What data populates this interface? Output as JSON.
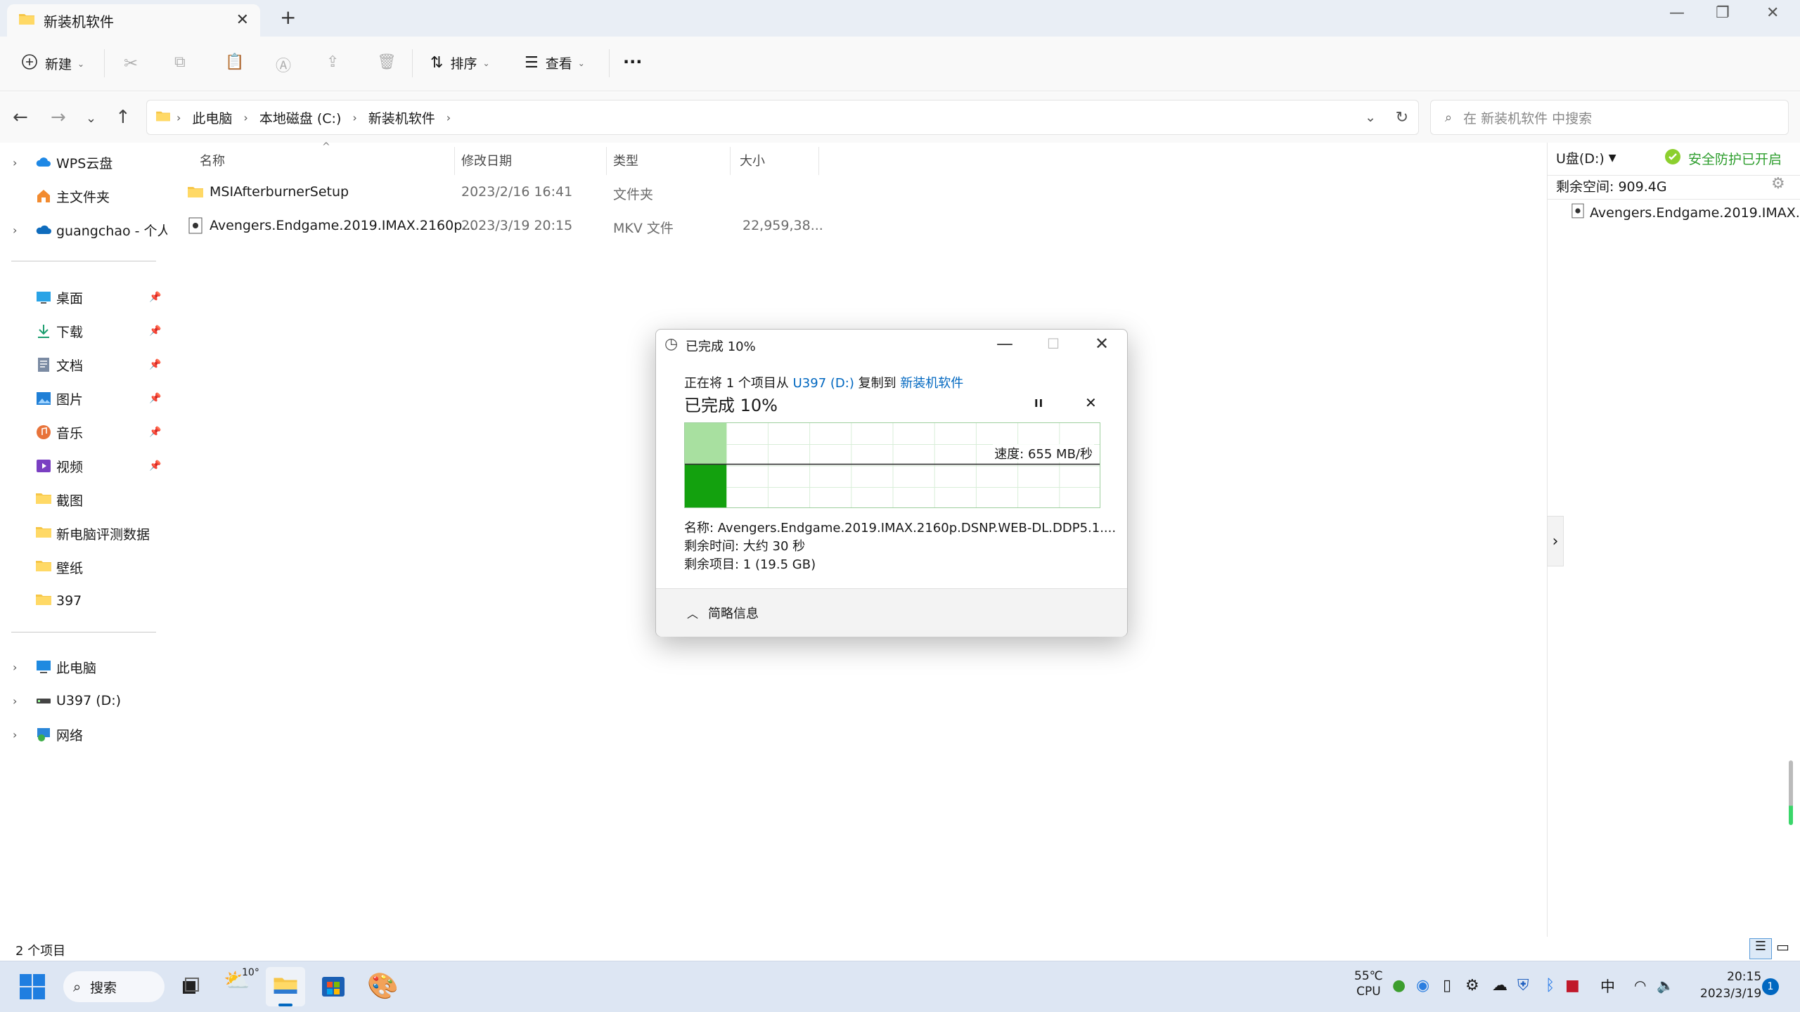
{
  "window": {
    "tab_title": "新装机软件",
    "tab_close": "✕",
    "new_tab": "+"
  },
  "toolbar": {
    "new_label": "新建",
    "sort_label": "排序",
    "view_label": "查看",
    "more_label": "···"
  },
  "address": {
    "crumbs": [
      "此电脑",
      "本地磁盘 (C:)",
      "新装机软件"
    ]
  },
  "search": {
    "placeholder": "在 新装机软件 中搜索"
  },
  "sidebar": {
    "top_items": [
      {
        "label": "WPS云盘",
        "icon": "cloud-icon"
      },
      {
        "label": "主文件夹",
        "icon": "home-icon"
      },
      {
        "label": "guangchao - 个人",
        "icon": "onedrive-icon"
      }
    ],
    "pinned": [
      {
        "label": "桌面",
        "icon": "desktop-icon"
      },
      {
        "label": "下载",
        "icon": "download-icon"
      },
      {
        "label": "文档",
        "icon": "document-icon"
      },
      {
        "label": "图片",
        "icon": "pictures-icon"
      },
      {
        "label": "音乐",
        "icon": "music-icon"
      },
      {
        "label": "视频",
        "icon": "video-icon"
      }
    ],
    "folders": [
      "截图",
      "新电脑评测数据",
      "壁纸",
      "397"
    ],
    "drives": [
      {
        "label": "此电脑",
        "icon": "computer-icon"
      },
      {
        "label": "U397 (D:)",
        "icon": "drive-icon"
      },
      {
        "label": "网络",
        "icon": "network-icon"
      }
    ]
  },
  "filelist": {
    "columns": [
      "名称",
      "修改日期",
      "类型",
      "大小"
    ],
    "rows": [
      {
        "name": "MSIAfterburnerSetup",
        "date": "2023/2/16 16:41",
        "type": "文件夹",
        "size": ""
      },
      {
        "name": "Avengers.Endgame.2019.IMAX.2160p...",
        "date": "2023/3/19 20:15",
        "type": "MKV 文件",
        "size": "22,959,38..."
      }
    ]
  },
  "right_panel": {
    "drive_label": "U盘(D:)",
    "protection_status": "安全防护已开启",
    "free_space": "剩余空间: 909.4G",
    "file_name": "Avengers.Endgame.2019.IMAX...",
    "expand_arrow": "›"
  },
  "status": {
    "item_count": "2 个项目"
  },
  "dialog": {
    "title": "已完成 10%",
    "desc_prefix": "正在将 1 个项目从 ",
    "source": "U397 (D:)",
    "desc_mid": " 复制到 ",
    "dest": "新装机软件",
    "heading": "已完成 10%",
    "pause_symbol": "II",
    "cancel_symbol": "✕",
    "speed": "速度: 655 MB/秒",
    "name_line": "名称:  Avengers.Endgame.2019.IMAX.2160p.DSNP.WEB-DL.DDP5.1....",
    "time_line": "剩余时间:  大约 30 秒",
    "items_line": "剩余项目:  1 (19.5 GB)",
    "summary": "简略信息",
    "progress_fraction": 0.1
  },
  "taskbar": {
    "search_label": "搜索",
    "weather_temp": "10°",
    "cpu_temp": "55℃",
    "cpu_label": "CPU",
    "ime": "中",
    "time": "20:15",
    "date": "2023/3/19",
    "notification_count": "1"
  },
  "colors": {
    "accent": "#0067c0",
    "progress_green": "#13a10e",
    "progress_light": "#a8e0a0",
    "protection_green": "#2e9e2e"
  }
}
